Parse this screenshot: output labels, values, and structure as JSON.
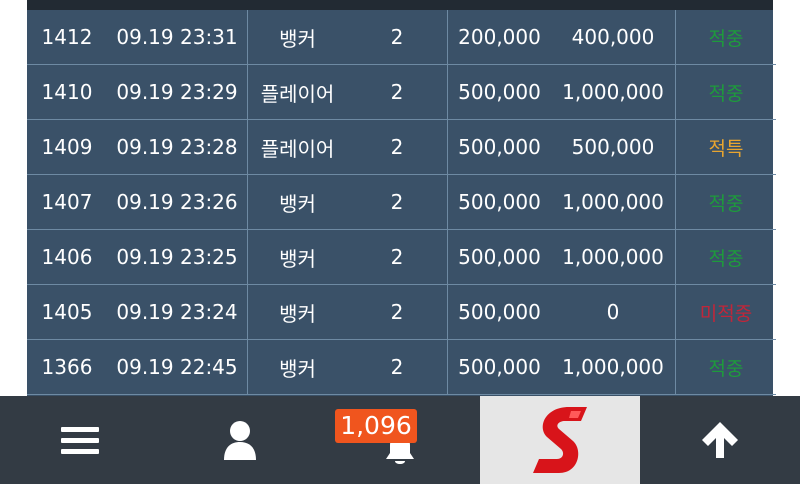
{
  "bets": [
    {
      "id": "1412",
      "time": "09.19 23:31",
      "pick": "뱅커",
      "odds": "2",
      "bet": "200,000",
      "win": "400,000",
      "result": "적중",
      "status": "win"
    },
    {
      "id": "1410",
      "time": "09.19 23:29",
      "pick": "플레이어",
      "odds": "2",
      "bet": "500,000",
      "win": "1,000,000",
      "result": "적중",
      "status": "win"
    },
    {
      "id": "1409",
      "time": "09.19 23:28",
      "pick": "플레이어",
      "odds": "2",
      "bet": "500,000",
      "win": "500,000",
      "result": "적특",
      "status": "hit"
    },
    {
      "id": "1407",
      "time": "09.19 23:26",
      "pick": "뱅커",
      "odds": "2",
      "bet": "500,000",
      "win": "1,000,000",
      "result": "적중",
      "status": "win"
    },
    {
      "id": "1406",
      "time": "09.19 23:25",
      "pick": "뱅커",
      "odds": "2",
      "bet": "500,000",
      "win": "1,000,000",
      "result": "적중",
      "status": "win"
    },
    {
      "id": "1405",
      "time": "09.19 23:24",
      "pick": "뱅커",
      "odds": "2",
      "bet": "500,000",
      "win": "0",
      "result": "미적중",
      "status": "miss"
    },
    {
      "id": "1366",
      "time": "09.19 22:45",
      "pick": "뱅커",
      "odds": "2",
      "bet": "500,000",
      "win": "1,000,000",
      "result": "적중",
      "status": "win"
    }
  ],
  "status_colors": {
    "win": "#1e9a3c",
    "hit": "#e8a530",
    "miss": "#c0263a"
  },
  "bottom_nav": {
    "notification_count": "1,096",
    "icons": [
      "menu-icon",
      "user-icon",
      "bell-icon",
      "site-logo",
      "arrow-up-icon"
    ]
  }
}
